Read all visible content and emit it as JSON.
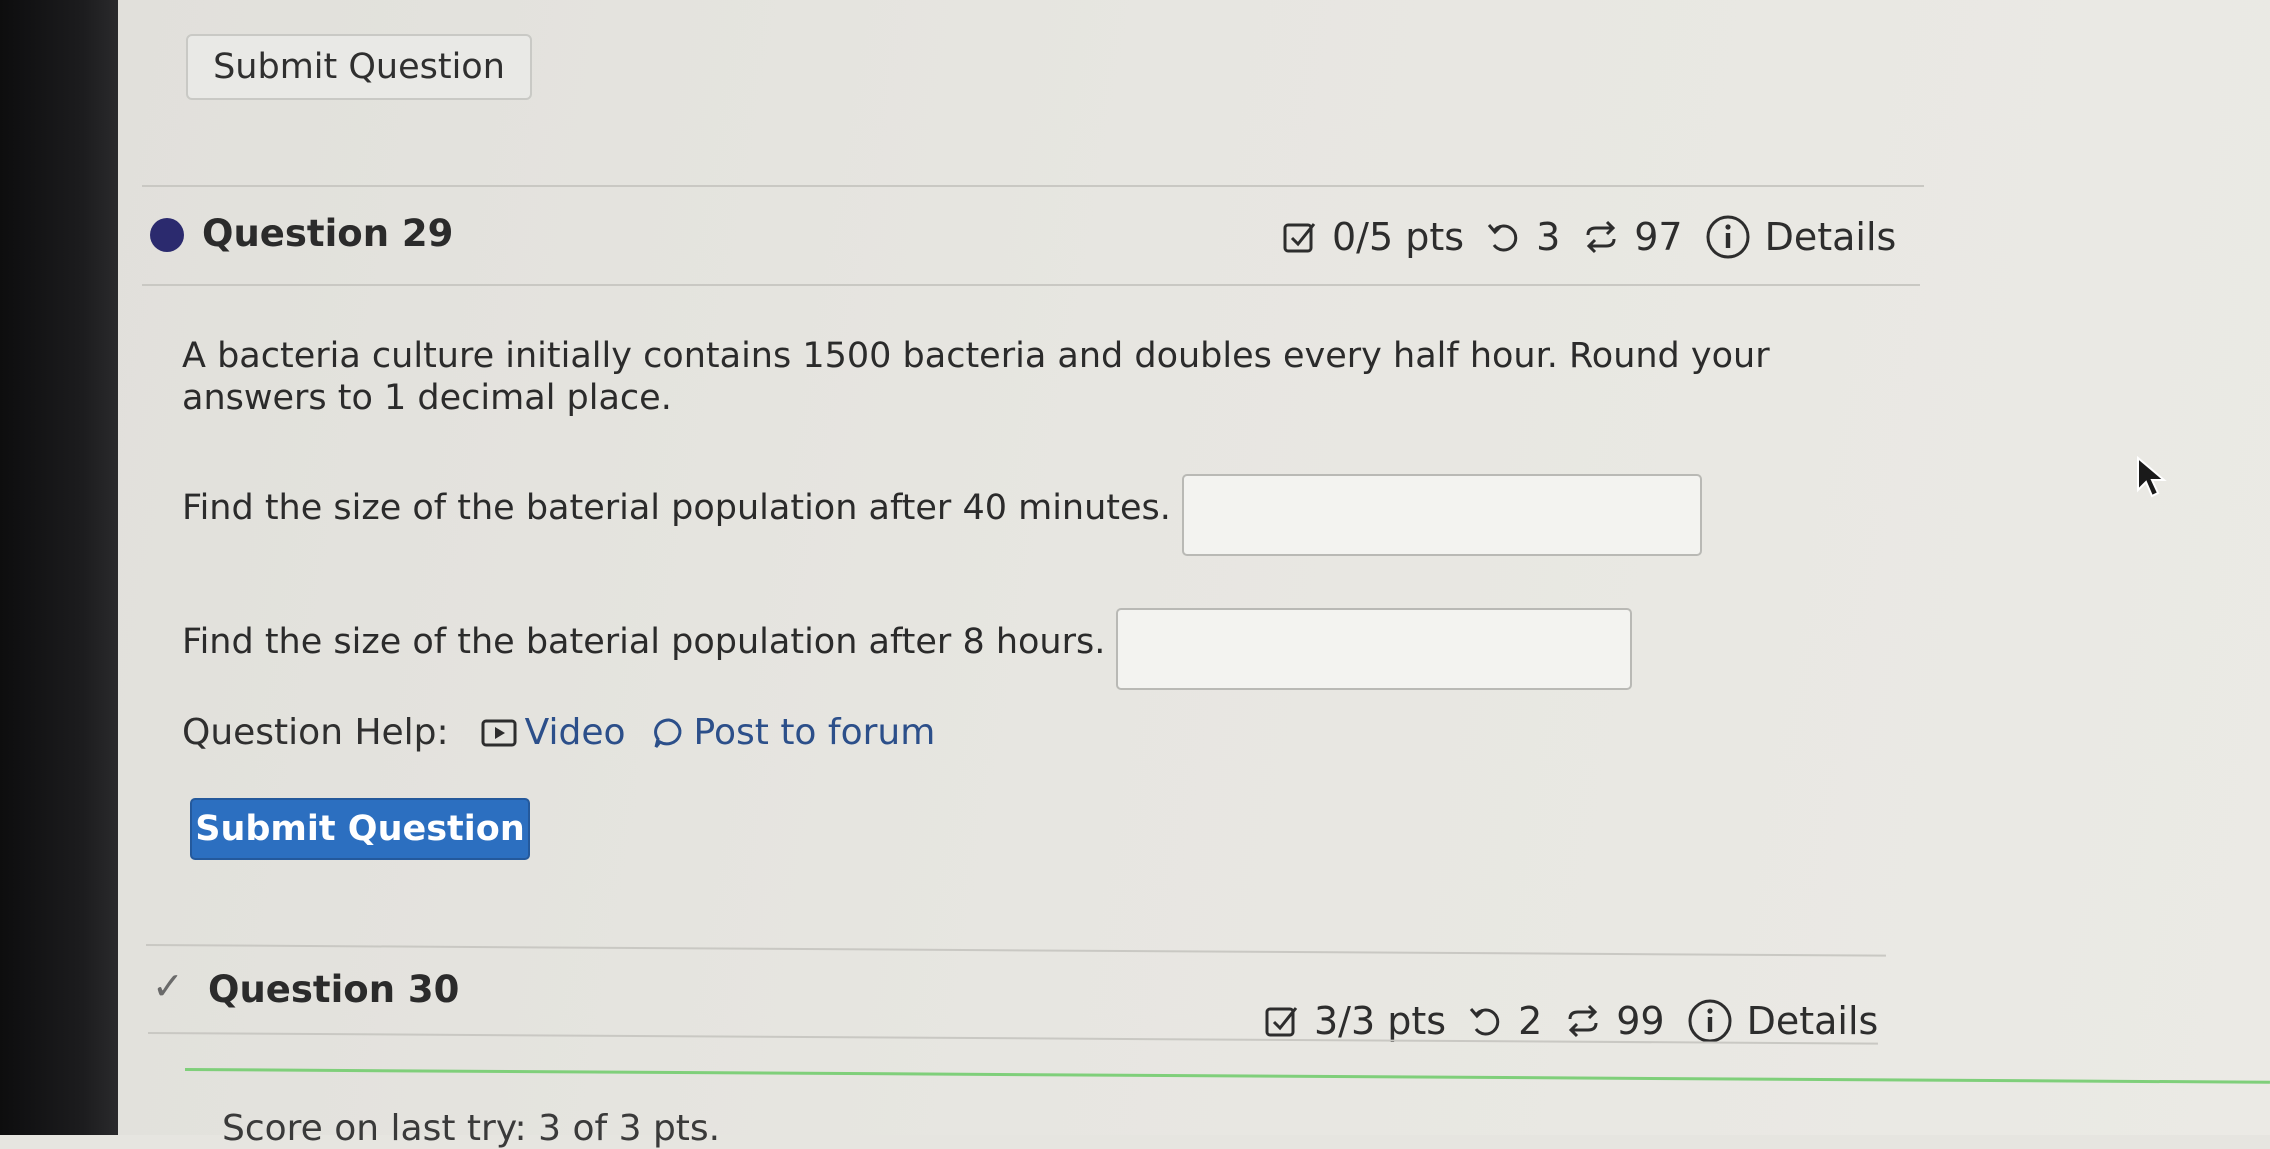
{
  "top_button": {
    "label": "Submit Question"
  },
  "question29": {
    "title": "Question 29",
    "points": "0/5 pts",
    "retries": "3",
    "attempts": "97",
    "details": "Details",
    "bullet_color": "#2b2a6e",
    "prompt_line1": "A bacteria culture initially contains 1500 bacteria and doubles every half hour. Round your",
    "prompt_line2": "answers to 1 decimal place.",
    "part1_label": "Find the size of the baterial population after 40 minutes.",
    "part1_value": "",
    "part2_label": "Find the size of the baterial population after 8 hours.",
    "part2_value": "",
    "help_label": "Question Help:",
    "help_video": "Video",
    "help_forum": "Post to forum",
    "submit_label": "Submit Question",
    "submit_color": "#2c6fc0"
  },
  "question30": {
    "title": "Question 30",
    "status_icon": "checkmark-icon",
    "points": "3/3 pts",
    "retries": "2",
    "attempts": "99",
    "details": "Details",
    "footer_partial": "Score on last try: 3 of 3 pts."
  },
  "icons": {
    "points": "checkbox-pencil-icon",
    "retries": "undo-arrow-icon",
    "attempts": "repeat-arrows-icon",
    "details": "info-circle-icon",
    "video": "play-box-icon",
    "forum": "speech-bubble-icon"
  }
}
